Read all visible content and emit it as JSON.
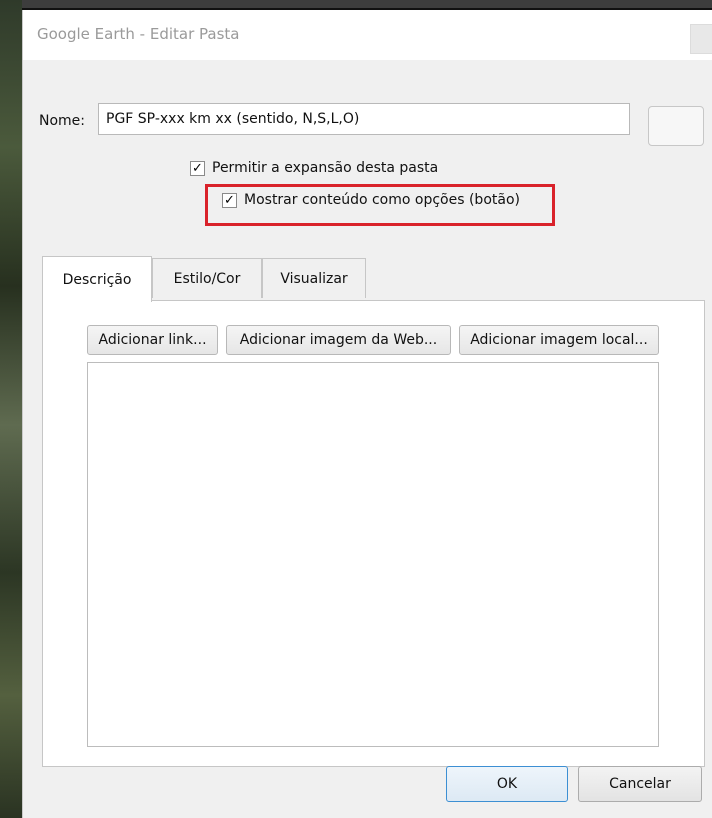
{
  "window": {
    "title": "Google Earth - Editar Pasta"
  },
  "name_field": {
    "label": "Nome:",
    "value": "PGF SP-xxx km xx (sentido, N,S,L,O)"
  },
  "options": {
    "allow_expand": {
      "label": "Permitir a expansão desta pasta",
      "checked": true
    },
    "show_as_options": {
      "label": "Mostrar conteúdo como opções (botão)",
      "checked": true
    },
    "check_mark": "✓"
  },
  "tabs": [
    {
      "label": "Descrição",
      "active": true
    },
    {
      "label": "Estilo/Cor",
      "active": false
    },
    {
      "label": "Visualizar",
      "active": false
    }
  ],
  "description_toolbar": {
    "add_link": "Adicionar link...",
    "add_web_image": "Adicionar imagem da Web...",
    "add_local_image": "Adicionar imagem local..."
  },
  "footer": {
    "ok": "OK",
    "cancel": "Cancelar"
  },
  "colors": {
    "highlight": "#d9222a",
    "ok_border": "#3c8fd3"
  }
}
